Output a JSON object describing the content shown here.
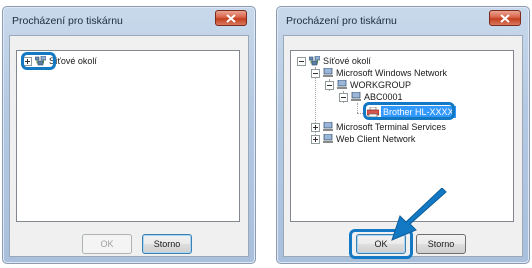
{
  "dialogs": [
    {
      "title": "Procházení pro tiskárnu",
      "tree": [
        {
          "label": "Síťové okolí",
          "expanded": false
        }
      ],
      "buttons": {
        "ok_label": "OK",
        "cancel_label": "Storno"
      }
    },
    {
      "title": "Procházení pro tiskárnu",
      "tree": [
        {
          "label": "Síťové okolí",
          "expanded": true
        },
        {
          "label": "Microsoft Windows Network",
          "expanded": true
        },
        {
          "label": "WORKGROUP",
          "expanded": true
        },
        {
          "label": "ABC0001",
          "expanded": true
        },
        {
          "label": "Brother HL-XXXX",
          "selected": true
        },
        {
          "label": "Microsoft Terminal Services",
          "expanded": false
        },
        {
          "label": "Web Client Network",
          "expanded": false
        }
      ],
      "buttons": {
        "ok_label": "OK",
        "cancel_label": "Storno"
      }
    }
  ],
  "icons": {
    "close": "close-icon",
    "network": "network-neighborhood-icon",
    "computer": "computer-icon",
    "printer": "printer-icon",
    "pointer": "pointer-arrow-icon"
  },
  "colors": {
    "highlight": "#1479c4",
    "selection": "#3399ff",
    "close_button": "#c2401f"
  }
}
